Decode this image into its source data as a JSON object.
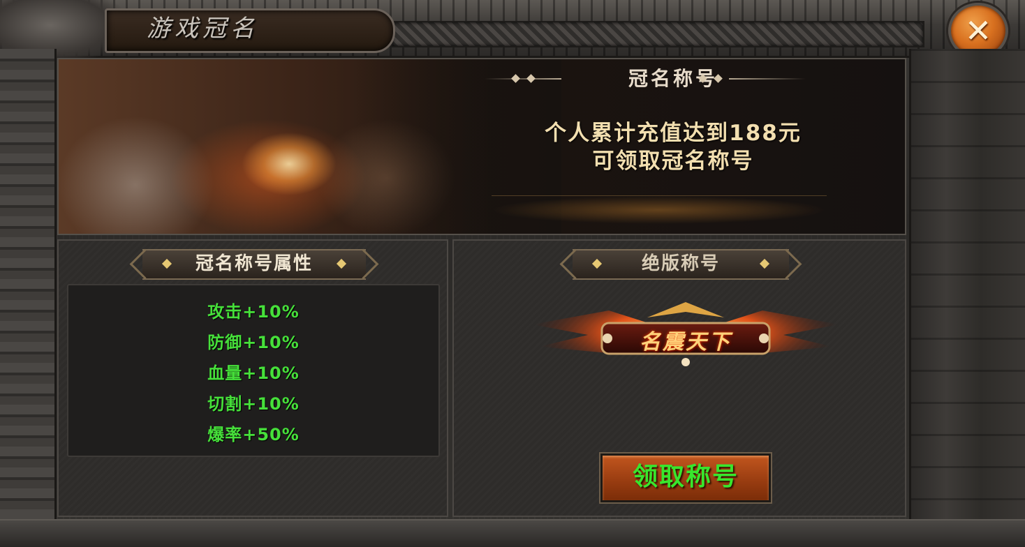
{
  "window": {
    "title": "游戏冠名",
    "close_symbol": "✕",
    "close_icon": "close-icon"
  },
  "banner": {
    "heading": "冠名称号",
    "desc_line1": "个人累计充值达到188元",
    "desc_line2": "可领取冠名称号"
  },
  "attributes_panel": {
    "heading": "冠名称号属性",
    "items": [
      {
        "label": "攻击+10%"
      },
      {
        "label": "防御+10%"
      },
      {
        "label": "血量+10%"
      },
      {
        "label": "切割+10%"
      },
      {
        "label": "爆率+50%"
      }
    ]
  },
  "title_panel": {
    "heading": "绝版称号",
    "title_emblem_text": "名震天下",
    "claim_button": "领取称号"
  },
  "colors": {
    "attribute_text": "#46e03a",
    "claim_text": "#38e62d",
    "claim_button": "#a8461a",
    "close_button": "#d8701f"
  }
}
